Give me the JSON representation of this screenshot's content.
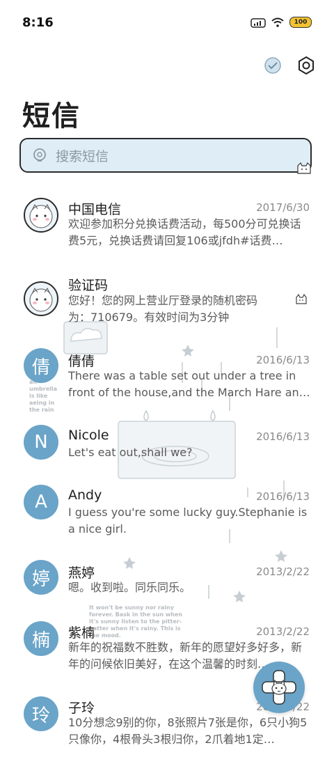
{
  "status_bar": {
    "time": "8:16",
    "battery": "100"
  },
  "header": {
    "title": "短信"
  },
  "search": {
    "placeholder": "搜索短信"
  },
  "conversations": [
    {
      "name": "中国电信",
      "date": "2017/6/30",
      "preview": "欢迎参加积分兑换话费活动，每500分可兑换话费5元，兑换话费请回复106或jfdh#话费…",
      "avatar_type": "image",
      "avatar_text": ""
    },
    {
      "name": "验证码",
      "date": "",
      "preview": "您好！您的网上营业厅登录的随机密码为：710679。有效时间为3分钟",
      "avatar_type": "image",
      "avatar_text": ""
    },
    {
      "name": "倩倩",
      "date": "2016/6/13",
      "preview": "There was a table set out under a tree in front of the house,and the March Hare an…",
      "avatar_type": "letter",
      "avatar_text": "倩"
    },
    {
      "name": "Nicole",
      "date": "2016/6/13",
      "preview": "Let's eat out,shall we?",
      "avatar_type": "letter",
      "avatar_text": "N"
    },
    {
      "name": "Andy",
      "date": "2016/6/13",
      "preview": "I guess you're some lucky guy.Stephanie is a nice girl.",
      "avatar_type": "letter",
      "avatar_text": "A"
    },
    {
      "name": "燕婷",
      "date": "2013/2/22",
      "preview": "嗯。收到啦。同乐同乐。",
      "avatar_type": "letter",
      "avatar_text": "婷"
    },
    {
      "name": "紫楠",
      "date": "2013/2/22",
      "preview": "新年的祝福数不胜数，新年的愿望好多好多，新年的问候依旧美好，在这个温馨的时刻…",
      "avatar_type": "letter",
      "avatar_text": "楠"
    },
    {
      "name": "子玲",
      "date": "2013/2/22",
      "preview": "10分想念9别的你，8张照片7张是你，6只小狗5只像你，4根骨头3根归你，2爪着地1定…",
      "avatar_type": "letter",
      "avatar_text": "玲"
    }
  ],
  "background_text": {
    "umbrella": "an umbrella is like aeing in the rain",
    "sunny": "It won't be sunny nor rainy forever. Bask in the sun when it's sunny listen to the pitter-patter when it's rainy. This is the mood."
  },
  "colors": {
    "accent": "#6aa4c8",
    "search_bg": "#dfeef6"
  }
}
